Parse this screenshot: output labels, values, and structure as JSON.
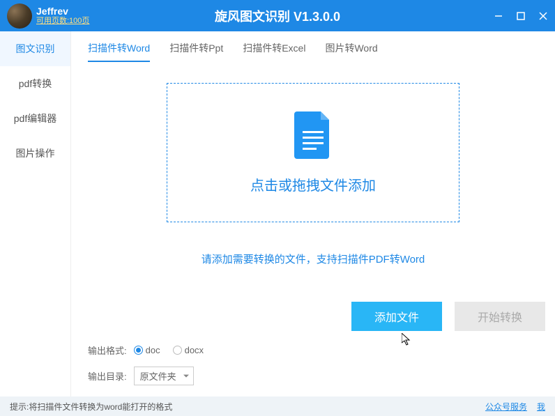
{
  "header": {
    "username": "Jeffrev",
    "quota": "可用页数:100页",
    "title": "旋风图文识别 V1.3.0.0"
  },
  "sidebar": {
    "items": [
      {
        "label": "图文识别"
      },
      {
        "label": "pdf转换"
      },
      {
        "label": "pdf编辑器"
      },
      {
        "label": "图片操作"
      }
    ]
  },
  "tabs": {
    "items": [
      {
        "label": "扫描件转Word"
      },
      {
        "label": "扫描件转Ppt"
      },
      {
        "label": "扫描件转Excel"
      },
      {
        "label": "图片转Word"
      }
    ]
  },
  "dropzone": {
    "text": "点击或拖拽文件添加"
  },
  "hint": "请添加需要转换的文件，支持扫描件PDF转Word",
  "actions": {
    "add": "添加文件",
    "start": "开始转换"
  },
  "options": {
    "format_label": "输出格式:",
    "format_doc": "doc",
    "format_docx": "docx",
    "dir_label": "输出目录:",
    "dir_value": "原文件夹"
  },
  "status": {
    "tip": "提示:将扫描件文件转换为word能打开的格式",
    "link1": "公众号服务",
    "link2": "我"
  }
}
